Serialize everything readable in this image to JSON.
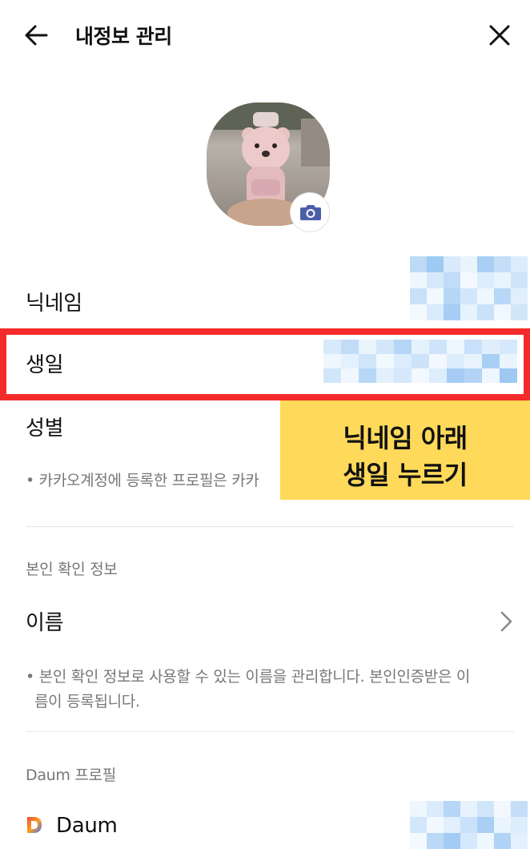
{
  "header": {
    "title": "내정보 관리",
    "back_icon": "arrow-left-icon",
    "close_icon": "close-icon"
  },
  "profile": {
    "camera_icon": "camera-icon",
    "accent_color": "#4a5fa8"
  },
  "fields": {
    "nickname_label": "닉네임",
    "birthday_label": "생일",
    "gender_label": "성별",
    "profile_note": "• 카카오계정에 등록한 프로필은 카카"
  },
  "callout": {
    "line1": "닉네임 아래",
    "line2": "생일 누르기",
    "background_color": "#ffd95a",
    "highlight_color": "#f52b2b"
  },
  "identity": {
    "section_title": "본인 확인 정보",
    "name_label": "이름",
    "note_line1": "• 본인 확인 정보로 사용할 수 있는 이름을 관리합니다. 본인인증받은 이",
    "note_line2": "름이 등록됩니다."
  },
  "daum": {
    "section_title": "Daum 프로필",
    "label": "Daum",
    "logo_icon": "daum-logo-icon"
  }
}
